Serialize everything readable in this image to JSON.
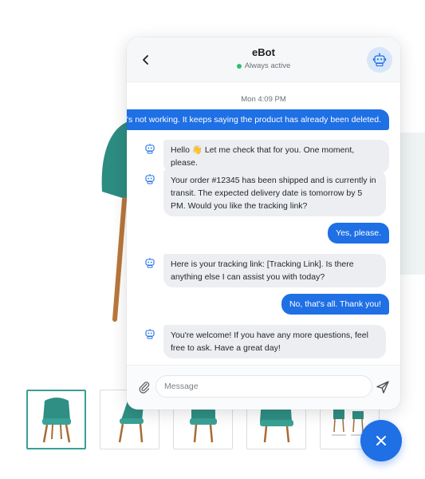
{
  "bot": {
    "name": "eBot",
    "status": "Always active",
    "avatar_icon": "robot-icon",
    "accent_color": "#1f6fe5",
    "online_color": "#2fbf71"
  },
  "conversation": {
    "timestamp": "Mon 4:09 PM",
    "messages": [
      {
        "from": "user",
        "text": "It's not working. It keeps saying the product has already been deleted."
      },
      {
        "from": "bot",
        "text": "Hello 👋 Let me check that for you. One moment, please."
      },
      {
        "from": "bot",
        "text": "Your order #12345 has been shipped and is currently in transit. The expected delivery date is tomorrow by 5 PM. Would you like the tracking link?"
      },
      {
        "from": "user",
        "text": "Yes, please."
      },
      {
        "from": "bot",
        "text": "Here is your tracking link: [Tracking Link]. Is there anything else I can assist you with today?"
      },
      {
        "from": "user",
        "text": "No, that's all. Thank you!"
      },
      {
        "from": "bot",
        "text": "You're welcome! If you have any more questions, feel free to ask. Have a great day!"
      }
    ]
  },
  "composer": {
    "placeholder": "Message",
    "value": ""
  },
  "icons": {
    "back": "chevron-left-icon",
    "attach": "paperclip-icon",
    "send": "send-icon",
    "close": "close-icon"
  },
  "product": {
    "thumbnail_count": 5,
    "active_thumbnail": 1
  }
}
